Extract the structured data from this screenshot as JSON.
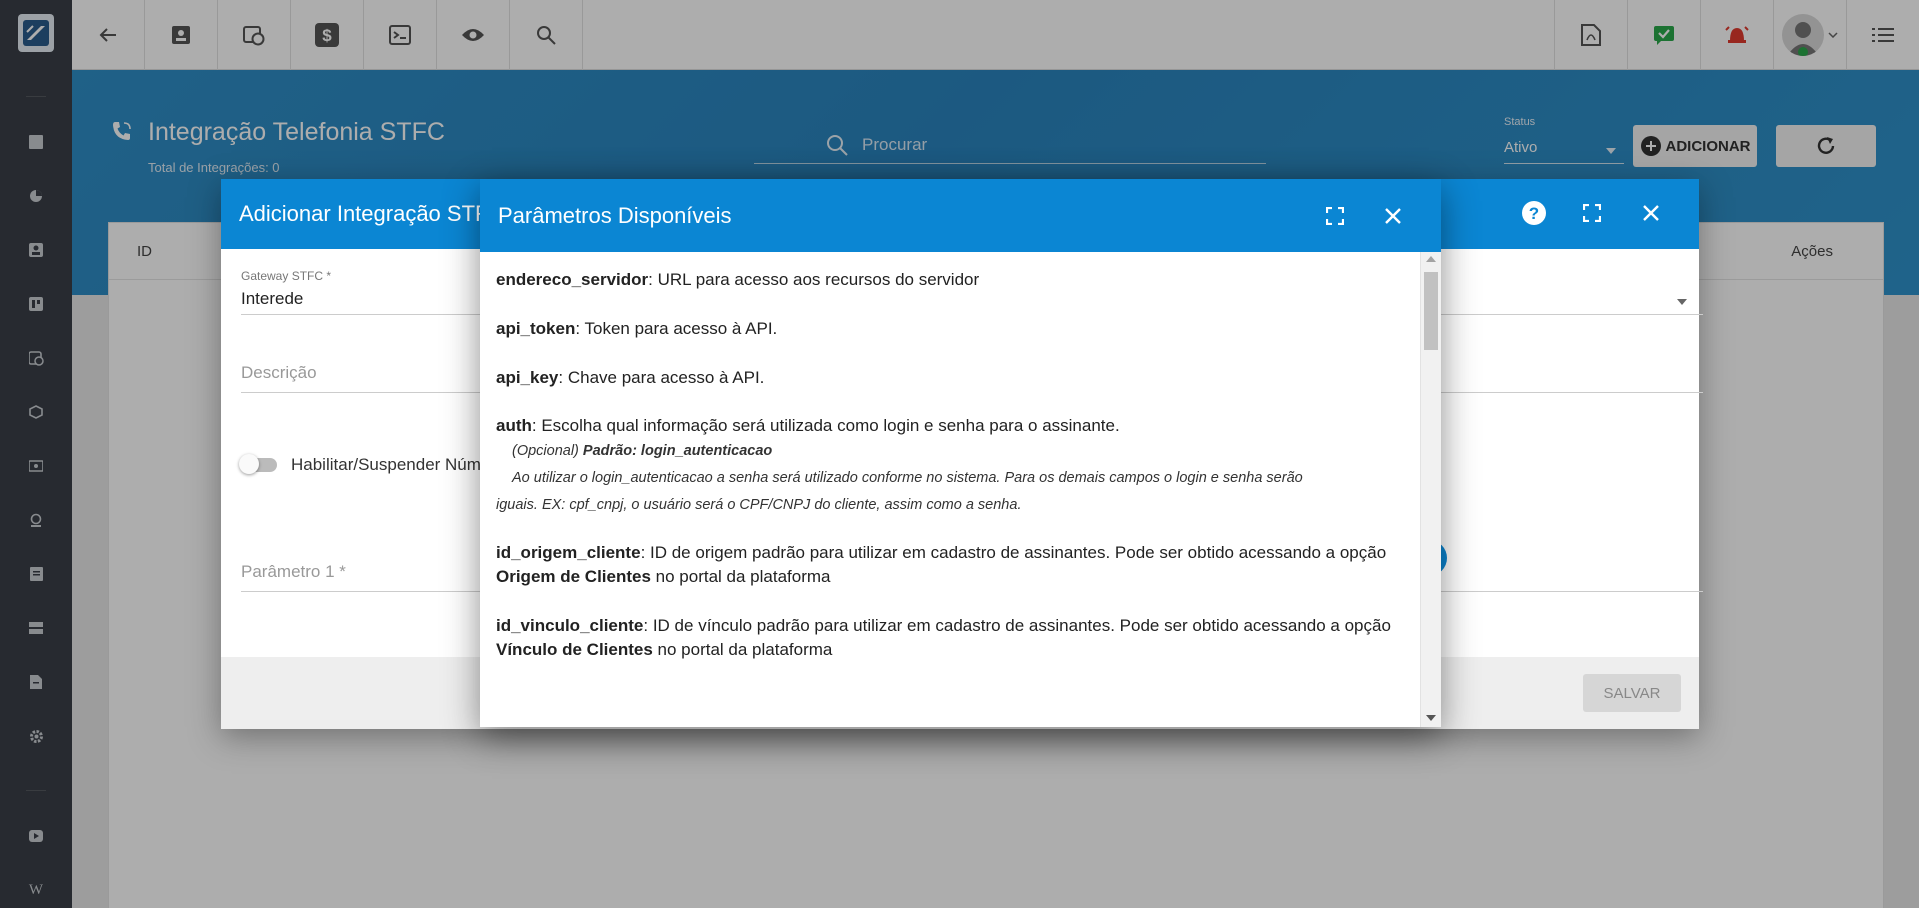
{
  "page": {
    "title": "Integração Telefonia STFC",
    "total": "Total de Integrações: 0",
    "search_placeholder": "Procurar",
    "status_label": "Status",
    "status_value": "Ativo",
    "add_label": "ADICIONAR"
  },
  "table": {
    "col_id": "ID",
    "col_actions": "Ações"
  },
  "sidebar": {
    "bottom_letter": "W"
  },
  "dialog_add": {
    "title": "Adicionar Integração STFC",
    "gateway_label": "Gateway STFC *",
    "gateway_value": "Interede",
    "description_placeholder": "Descrição",
    "switch_label": "Habilitar/Suspender Números",
    "param1_placeholder": "Parâmetro 1 *",
    "save_label": "SALVAR"
  },
  "dialog_params": {
    "title": "Parâmetros Disponíveis",
    "items": [
      {
        "key": "endereco_servidor",
        "desc": ": URL para acesso aos recursos do servidor"
      },
      {
        "key": "api_token",
        "desc": ": Token para acesso à API."
      },
      {
        "key": "api_key",
        "desc": ": Chave para acesso à API."
      },
      {
        "key": "auth",
        "desc": ": Escolha qual informação será utilizada como login e senha para o assinante.",
        "note_optional": "(Opcional) ",
        "note_default": "Padrão: login_autenticacao",
        "note_1": "Ao utilizar o login_autenticacao a senha será utilizado conforme no sistema. Para os demais campos o login e senha serão",
        "note_2": "iguais. EX: cpf_cnpj, o usuário será o CPF/CNPJ do cliente, assim como a senha."
      },
      {
        "key": "id_origem_cliente",
        "desc": ": ID de origem padrão para utilizar em cadastro de assinantes. Pode ser obtido acessando a opção ",
        "bold": "Origem de Clientes",
        "tail": " no portal da plataforma"
      },
      {
        "key": "id_vinculo_cliente",
        "desc": ": ID de vínculo padrão para utilizar em cadastro de assinantes. Pode ser obtido acessando a opção ",
        "bold": "Vínculo de Clientes",
        "tail": " no portal da plataforma"
      }
    ]
  },
  "colors": {
    "primary": "#0b86d3",
    "sidebar": "#3a3f47",
    "header": "#2a84be"
  }
}
